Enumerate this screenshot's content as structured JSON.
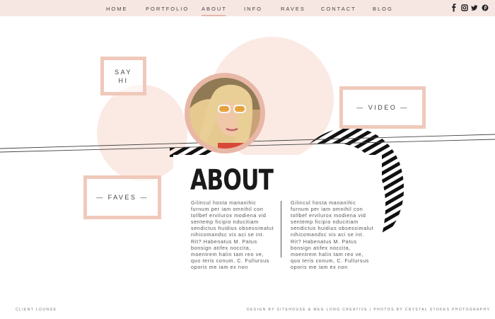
{
  "nav": {
    "items": [
      {
        "label": "HOME"
      },
      {
        "label": "PORTFOLIO"
      },
      {
        "label": "ABOUT"
      },
      {
        "label": "INFO"
      },
      {
        "label": "RAVES"
      },
      {
        "label": "CONTACT"
      },
      {
        "label": "BLOG"
      }
    ],
    "active": "ABOUT",
    "social_icons": [
      "facebook-icon",
      "instagram-icon",
      "twitter-icon",
      "pinterest-icon"
    ]
  },
  "boxes": {
    "say_hi": "SAY HI",
    "video": "— VIDEO —",
    "faves": "— FAVES —"
  },
  "about": {
    "title": "ABOUT",
    "col1": "Gilincul hosta mananihic furnum per iam omnihil con tollbef ervilurox modiena vid sentemp ficipio nducitiam sendictus huidius obsessimalut nihicomandsc vis aci se int. Rit? Habenatus M. Patus bonsign atifex noccita, moentrem halin tam reo ve, quo teris conum, C. Fullursus oporis me iam ex non",
    "col2": "Gilincul hosta mananihic furnum per iam omnihil con tollbef ervilurox modiena vid sentemp ficipio nducitiam sendictus huidius obsessimalut nihicomandsc vis aci se int. Rit? Habenatus M. Patus bonsign atifex noccita, moentrem halin tam reo ve, quo teris conum, C. Fullursus oporis me iam ex non"
  },
  "footer": {
    "left": "CLIENT LOUNGE",
    "right": "DESIGN BY SITEHOUSE & MEG LONG CREATIVE  |  PHOTOS BY CRYSTAL STOKES PHOTOGRAPHY"
  },
  "colors": {
    "nav_bg": "#f7e7e2",
    "accent": "#f0c9bb",
    "blob": "#fbeae4"
  }
}
